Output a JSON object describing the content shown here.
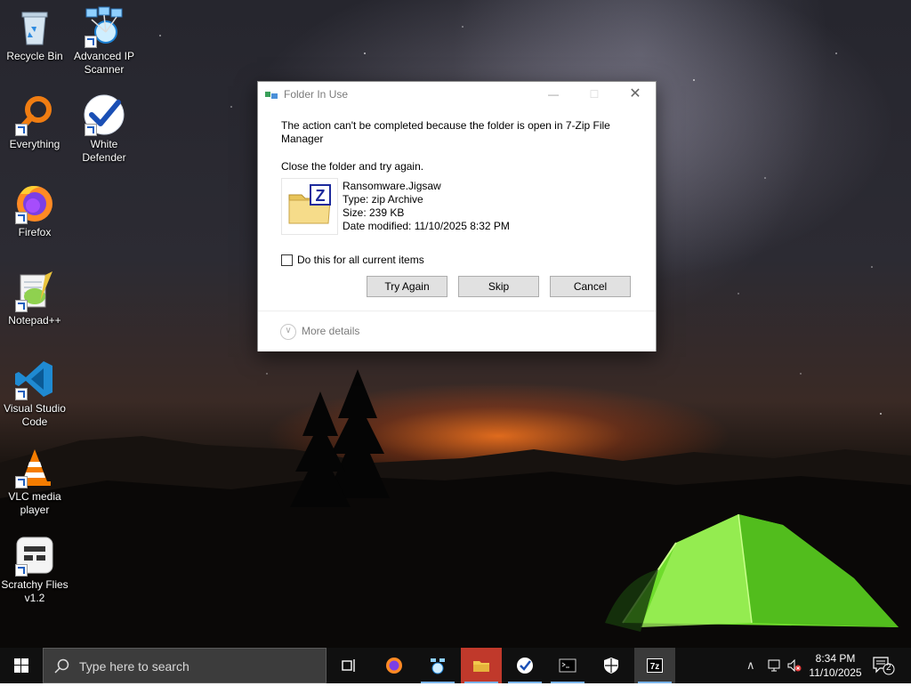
{
  "desktop": {
    "icons": [
      {
        "label": "Recycle Bin",
        "icon": "recycle-bin-icon"
      },
      {
        "label": "Advanced IP Scanner",
        "icon": "advanced-ip-scanner-icon"
      },
      {
        "label": "Everything",
        "icon": "everything-search-icon"
      },
      {
        "label": "White Defender",
        "icon": "white-defender-icon"
      },
      {
        "label": "Firefox",
        "icon": "firefox-icon"
      },
      {
        "label": "Notepad++",
        "icon": "notepadpp-icon"
      },
      {
        "label": "Visual Studio Code",
        "icon": "vscode-icon"
      },
      {
        "label": "VLC media player",
        "icon": "vlc-icon"
      },
      {
        "label": "Scratchy Flies v1.2",
        "icon": "scratchy-flies-icon"
      }
    ]
  },
  "dialog": {
    "title": "Folder In Use",
    "message": "The action can't be completed because the folder is open in 7-Zip File Manager",
    "instruction": "Close the folder and try again.",
    "file": {
      "name": "Ransomware.Jigsaw",
      "type": "Type: zip Archive",
      "size": "Size: 239 KB",
      "modified": "Date modified: 11/10/2025 8:32 PM"
    },
    "checkbox_label": "Do this for all current items",
    "checkbox_checked": false,
    "buttons": {
      "try_again": "Try Again",
      "skip": "Skip",
      "cancel": "Cancel"
    },
    "more_details": "More details"
  },
  "taskbar": {
    "search_placeholder": "Type here to search",
    "apps": [
      "task-view-icon",
      "firefox-icon",
      "advanced-ip-scanner-icon",
      "file-explorer-icon",
      "white-defender-icon",
      "terminal-icon",
      "security-shield-icon",
      "7zip-icon"
    ],
    "clock_time": "8:34 PM",
    "clock_date": "11/10/2025",
    "notification_count": "2"
  },
  "colors": {
    "taskbar": "#101010",
    "search_box": "#3c3c3c",
    "accent": "#0078d7",
    "button_face": "#e1e1e1"
  }
}
